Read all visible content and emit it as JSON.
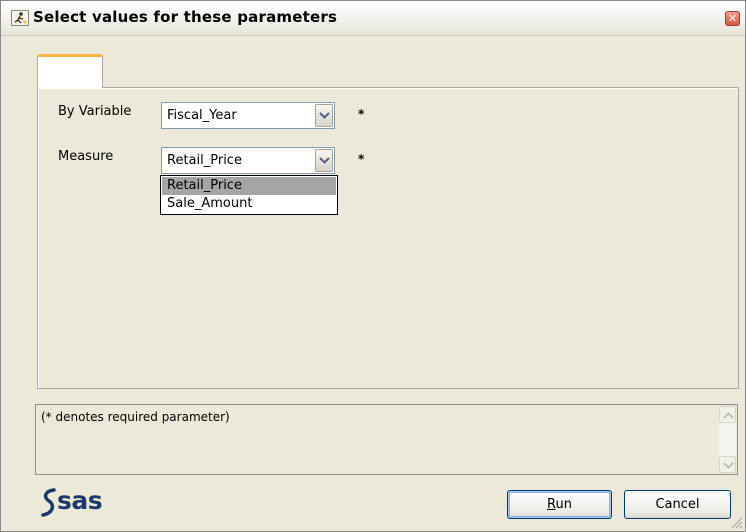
{
  "window": {
    "title": "Select values for these parameters",
    "icons": {
      "app": "running-man-icon",
      "close": "close-x-icon"
    }
  },
  "tabs": [
    {
      "label": ""
    }
  ],
  "form": {
    "by_variable": {
      "label": "By Variable",
      "value": "Fiscal_Year",
      "required_marker": "*"
    },
    "measure": {
      "label": "Measure",
      "value": "Retail_Price",
      "required_marker": "*",
      "options": [
        "Retail_Price",
        "Sale_Amount"
      ],
      "highlighted_option": "Retail_Price"
    }
  },
  "description": {
    "text": "(* denotes required parameter)"
  },
  "footer": {
    "logo_text": "sas",
    "run_label": "Run",
    "run_mnemonic": "R",
    "run_rest": "un",
    "cancel_label": "Cancel"
  },
  "colors": {
    "tab_accent": "#f7b346",
    "dialog_bg": "#ece9d8",
    "close_button": "#d6583c",
    "logo": "#1b3a6b"
  }
}
